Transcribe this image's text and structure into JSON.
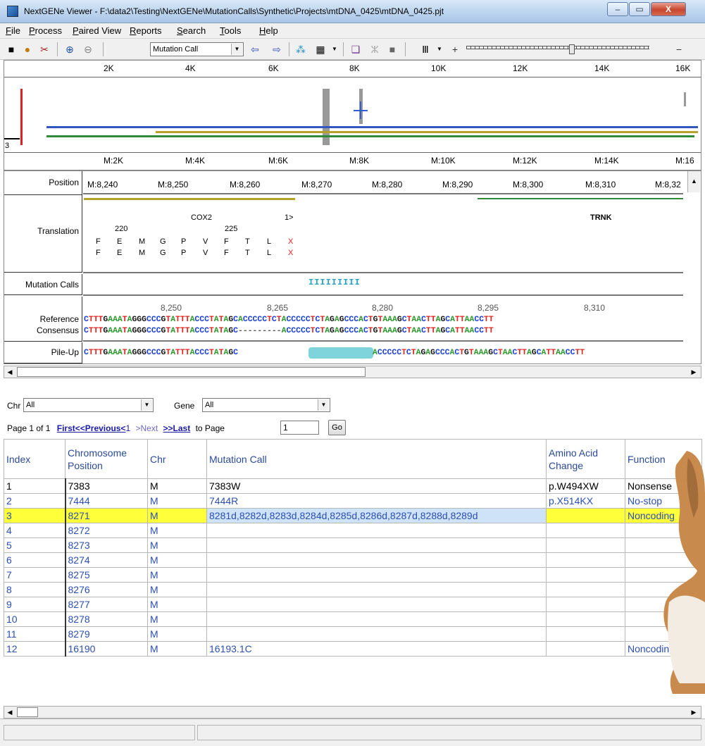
{
  "window": {
    "title": "NextGENe Viewer - F:\\data2\\Testing\\NextGENe\\MutationCalls\\Synthetic\\Projects\\mtDNA_0425\\mtDNA_0425.pjt",
    "minimize": "‒",
    "maximize": "▭",
    "close": "X"
  },
  "menu": [
    "File",
    "Process",
    "Paired View",
    "Reports",
    "Search",
    "Tools",
    "Help"
  ],
  "toolbar": {
    "mode": "Mutation Call"
  },
  "overview": {
    "top_ticks": [
      "2K",
      "4K",
      "6K",
      "8K",
      "10K",
      "12K",
      "14K",
      "16K"
    ],
    "bottom_ticks": [
      "M:2K",
      "M:4K",
      "M:6K",
      "M:8K",
      "M:10K",
      "M:12K",
      "M:14K",
      "M:16"
    ],
    "depth_label": "3"
  },
  "seqview": {
    "labels": {
      "position": "Position",
      "translation": "Translation",
      "mutation_calls": "Mutation Calls",
      "reference": "Reference",
      "consensus": "Consensus",
      "pileup": "Pile-Up"
    },
    "positions": [
      "M:8,240",
      "M:8,250",
      "M:8,260",
      "M:8,270",
      "M:8,280",
      "M:8,290",
      "M:8,300",
      "M:8,310",
      "M:8,32"
    ],
    "translation": {
      "gene1": "COX2",
      "gene2": "TRNK",
      "marker": "1>",
      "num220": "220",
      "num225": "225",
      "row1": [
        "F",
        "E",
        "M",
        "G",
        "P",
        "V",
        "F",
        "T",
        "L",
        "X"
      ],
      "row2": [
        "F",
        "E",
        "M",
        "G",
        "P",
        "V",
        "F",
        "T",
        "L",
        "X"
      ]
    },
    "mutation_ticks": "IIIIIIIII",
    "ref_positions": [
      "8,250",
      "8,265",
      "8,280",
      "8,295",
      "8,310"
    ],
    "reference": "CTTTGAAATAGGGCCCGTATTTACCCTATAGCACCCCCTCTACCCCCTCTAGAGCCCACTGTAAAGCTAACTTAGCATTAACCTT",
    "consensus": "CTTTGAAATAGGGCCCGTATTTACCCTATAGC---------ACCCCCTCTAGAGCCCACTGTAAAGCTAACTTAGCATTAACCTT",
    "pileup_left": "CTTTGAAATAGGGCCCGTATTTACCCTATAGC",
    "pileup_right": "ACCCCCTCTAGAGCCCACTGTAAAGCTAACTTAGCATTAACCTT"
  },
  "filters": {
    "chr_label": "Chr",
    "chr_value": "All",
    "gene_label": "Gene",
    "gene_value": "All"
  },
  "paging": {
    "page_info": "Page 1 of 1",
    "first": "First<<",
    "previous": "Previous<",
    "current": "1",
    "next": ">Next",
    "last": ">>Last",
    "to_page": "to Page",
    "page_value": "1",
    "go": "Go"
  },
  "table": {
    "headers": [
      "Index",
      "Chromosome Position",
      "Chr",
      "Mutation Call",
      "Amino Acid Change",
      "Function"
    ],
    "rows": [
      [
        "1",
        "7383",
        "M",
        "7383W",
        "p.W494XW",
        "Nonsense"
      ],
      [
        "2",
        "7444",
        "M",
        "7444R",
        "p.X514KX",
        "No-stop"
      ],
      [
        "3",
        "8271",
        "M",
        "8281d,8282d,8283d,8284d,8285d,8286d,8287d,8288d,8289d",
        "",
        "Noncoding"
      ],
      [
        "4",
        "8272",
        "M",
        "",
        "",
        ""
      ],
      [
        "5",
        "8273",
        "M",
        "",
        "",
        ""
      ],
      [
        "6",
        "8274",
        "M",
        "",
        "",
        ""
      ],
      [
        "7",
        "8275",
        "M",
        "",
        "",
        ""
      ],
      [
        "8",
        "8276",
        "M",
        "",
        "",
        ""
      ],
      [
        "9",
        "8277",
        "M",
        "",
        "",
        ""
      ],
      [
        "10",
        "8278",
        "M",
        "",
        "",
        ""
      ],
      [
        "11",
        "8279",
        "M",
        "",
        "",
        ""
      ],
      [
        "12",
        "16190",
        "M",
        "16193.1C",
        "",
        "Noncoding"
      ]
    ]
  },
  "colors": {
    "A": "#2e9a2e",
    "C": "#1b3fd8",
    "G": "#111111",
    "T": "#e0221b",
    "highlight": "#ffff3a",
    "mutation_ticks": "#2aa3c0",
    "pileup_gap": "#7fd3da"
  }
}
